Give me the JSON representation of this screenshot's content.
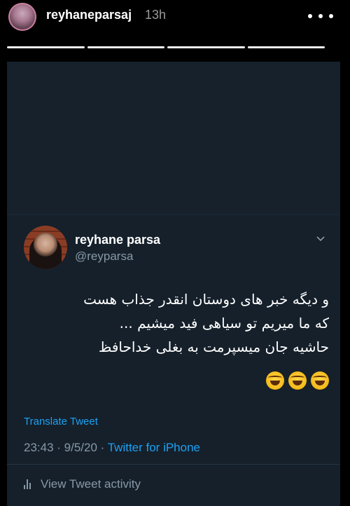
{
  "story": {
    "username": "reyhaneparsaj",
    "time": "13h",
    "segments": 4
  },
  "tweet": {
    "author_name": "reyhane parsa",
    "author_handle": "@reyparsa",
    "text_lines": [
      "و دیگه خبر های دوستان انقدر جذاب هست",
      "که ما میریم تو سیاهی فید میشیم ...",
      "حاشیه  جان میسپرمت به بغلی خداحافظ"
    ],
    "emojis": [
      "face-with-tears-of-joy",
      "face-with-tears-of-joy",
      "face-with-tears-of-joy"
    ],
    "translate_label": "Translate Tweet",
    "timestamp": "23:43 · 9/5/20 · ",
    "source": "Twitter for iPhone",
    "activity_label": "View Tweet activity"
  },
  "colors": {
    "card_bg": "#15202b",
    "link": "#1da1f2",
    "secondary_text": "#8899a6"
  }
}
